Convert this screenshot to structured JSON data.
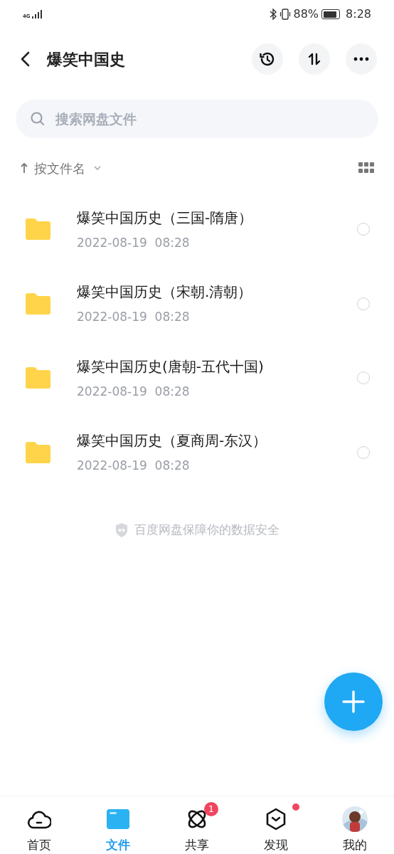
{
  "status_bar": {
    "network": "4G",
    "battery": "88%",
    "time": "8:28"
  },
  "header": {
    "title": "爆笑中国史"
  },
  "search": {
    "placeholder": "搜索网盘文件"
  },
  "sort": {
    "label": "按文件名"
  },
  "files": [
    {
      "name": "爆笑中国历史（三国-隋唐）",
      "date": "2022-08-19  08:28",
      "selected": false
    },
    {
      "name": "爆笑中国历史（宋朝.清朝）",
      "date": "2022-08-19  08:28",
      "selected": false
    },
    {
      "name": "爆笑中国历史(唐朝-五代十国)",
      "date": "2022-08-19  08:28",
      "selected": false
    },
    {
      "name": "爆笑中国历史（夏商周-东汉）",
      "date": "2022-08-19  08:28",
      "selected": false
    }
  ],
  "footer_note": "百度网盘保障你的数据安全",
  "nav": [
    {
      "kind": "home",
      "label": "首页",
      "selected": false
    },
    {
      "kind": "files",
      "label": "文件",
      "selected": true
    },
    {
      "kind": "share",
      "label": "共享",
      "selected": false,
      "badge": "1"
    },
    {
      "kind": "discover",
      "label": "发现",
      "selected": false,
      "dot": true
    },
    {
      "kind": "me",
      "label": "我的",
      "selected": false
    }
  ]
}
